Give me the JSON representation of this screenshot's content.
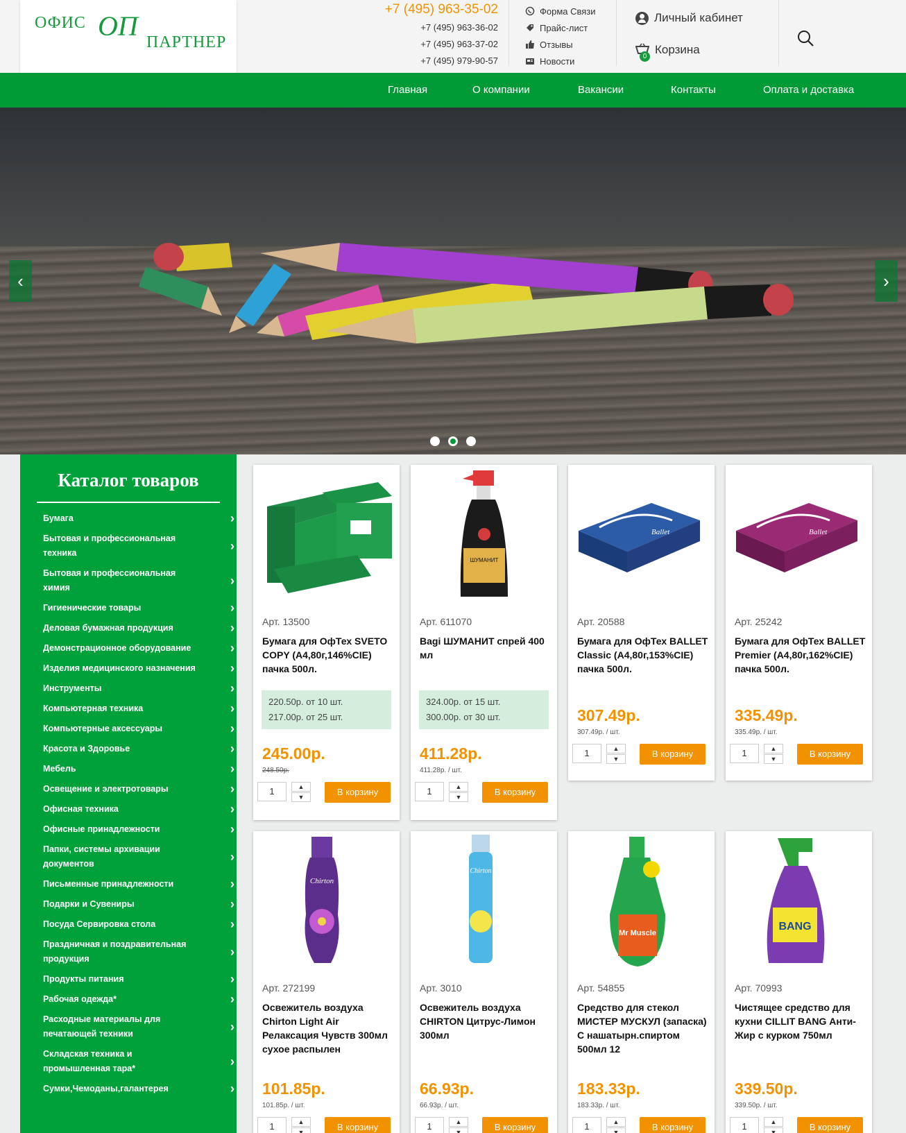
{
  "header": {
    "logo_left": "ОФИС",
    "logo_mono": "ОП",
    "logo_right": "ПАРТНЕР",
    "phone_main": "+7 (495) 963-35-02",
    "phones": [
      "+7 (495) 963-36-02",
      "+7 (495) 963-37-02",
      "+7 (495) 979-90-57"
    ],
    "links": [
      {
        "label": "Форма Связи",
        "icon": "whatsapp-icon"
      },
      {
        "label": "Прайс-лист",
        "icon": "tag-icon"
      },
      {
        "label": "Отзывы",
        "icon": "thumbs-up-icon"
      },
      {
        "label": "Новости",
        "icon": "news-icon"
      }
    ],
    "account_label": "Личный кабинет",
    "cart_label": "Корзина",
    "cart_count": "0"
  },
  "nav": {
    "items": [
      "Главная",
      "О компании",
      "Вакансии",
      "Контакты",
      "Оплата и доставка"
    ]
  },
  "slider": {
    "prev": "‹",
    "next": "›",
    "active_dot": 1,
    "dots": 3
  },
  "catalog": {
    "title": "Каталог товаров",
    "items": [
      "Бумага",
      "Бытовая и профессиональная техника",
      "Бытовая и профессиональная химия",
      "Гигиенические товары",
      "Деловая бумажная продукция",
      "Демонстрационное оборудование",
      "Изделия медицинского назначения",
      "Инструменты",
      "Компьютерная техника",
      "Компьютерные аксессуары",
      "Красота и Здоровье",
      "Мебель",
      "Освещение и электротовары",
      "Офисная техника",
      "Офисные принадлежности",
      "Папки, системы архивации документов",
      "Письменные принадлежности",
      "Подарки и Сувениры",
      "Посуда Сервировка стола",
      "Праздничная и поздравительная продукция",
      "Продукты питания",
      "Рабочая одежда*",
      "Расходные материалы для печатающей техники",
      "Складская техника и промышленная тара*",
      "Сумки,Чемоданы,галантерея"
    ]
  },
  "buttons": {
    "to_cart": "В корзину",
    "qty": "1",
    "up": "▲",
    "down": "▼"
  },
  "products": [
    {
      "art": "Арт. 13500",
      "name": "Бумага для ОфТех SVETO COPY (А4,80г,146%CIE) пачка 500л.",
      "tiers": [
        "220.50р. от 10 шт.",
        "217.00р. от 25 шт."
      ],
      "price": "245.00р.",
      "sub": "248.50р.",
      "strike": true
    },
    {
      "art": "Арт. 611070",
      "name": "Bagi ШУМАНИТ спрей 400 мл",
      "tiers": [
        "324.00р. от 15 шт.",
        "300.00р. от 30 шт."
      ],
      "price": "411.28р.",
      "sub": "411.28р. / шт.",
      "strike": false
    },
    {
      "art": "Арт. 20588",
      "name": "Бумага для ОфТех BALLET Classic (А4,80г,153%CIE) пачка 500л.",
      "tiers": [],
      "price": "307.49р.",
      "sub": "307.49р. / шт.",
      "strike": false
    },
    {
      "art": "Арт. 25242",
      "name": "Бумага для ОфТех BALLET Premier (А4,80г,162%CIE) пачка 500л.",
      "tiers": [],
      "price": "335.49р.",
      "sub": "335.49р. / шт.",
      "strike": false
    },
    {
      "art": "Арт. 272199",
      "name": "Освежитель воздуха Chirton Light Air Релаксация Чувств 300мл сухое распылен",
      "tiers": [],
      "price": "101.85р.",
      "sub": "101.85р. / шт.",
      "strike": false
    },
    {
      "art": "Арт. 3010",
      "name": "Освежитель воздуха CHIRTON Цитрус-Лимон 300мл",
      "tiers": [],
      "price": "66.93р.",
      "sub": "66.93р. / шт.",
      "strike": false
    },
    {
      "art": "Арт. 54855",
      "name": "Средство для стекол МИСТЕР МУСКУЛ (запаска) С нашатырн.спиртом 500мл 12",
      "tiers": [],
      "price": "183.33р.",
      "sub": "183.33р. / шт.",
      "strike": false
    },
    {
      "art": "Арт. 70993",
      "name": "Чистящее средство для кухни CILLIT BANG Анти-Жир с курком 750мл",
      "tiers": [],
      "price": "339.50р.",
      "sub": "339.50р. / шт.",
      "strike": false
    }
  ],
  "colors": {
    "green": "#009a36",
    "orange": "#f39200"
  }
}
